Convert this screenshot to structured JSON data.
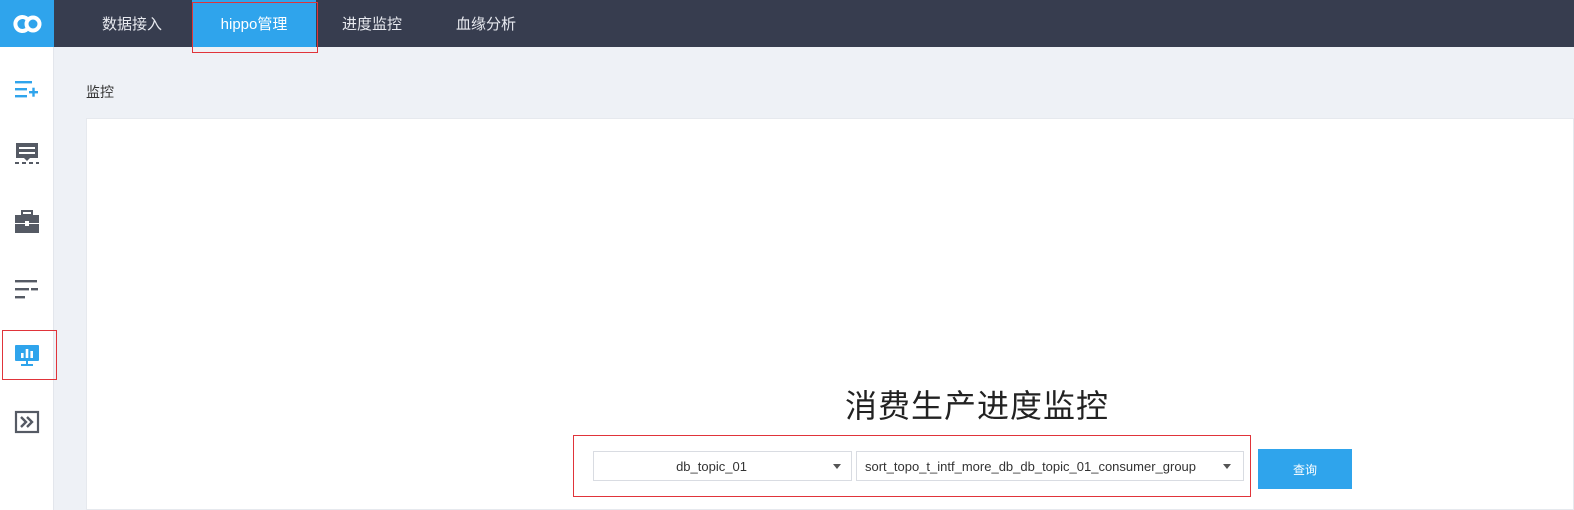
{
  "header": {
    "logo_icon": "co-logo-icon",
    "tabs": [
      {
        "label": "数据接入",
        "active": false
      },
      {
        "label": "hippo管理",
        "active": true
      },
      {
        "label": "进度监控",
        "active": false
      },
      {
        "label": "血缘分析",
        "active": false
      }
    ]
  },
  "sidebar": {
    "items": [
      {
        "icon": "list-add-icon",
        "active": false
      },
      {
        "icon": "message-board-icon",
        "active": false
      },
      {
        "icon": "toolbox-icon",
        "active": false
      },
      {
        "icon": "align-left-icon",
        "active": false
      },
      {
        "icon": "monitor-chart-icon",
        "active": true
      },
      {
        "icon": "double-chevron-right-icon",
        "active": false
      }
    ]
  },
  "breadcrumb": "监控",
  "main": {
    "title": "消费生产进度监控",
    "topic_select": {
      "value": "db_topic_01"
    },
    "group_select": {
      "value": "sort_topo_t_intf_more_db_db_topic_01_consumer_group"
    },
    "query_label": "查询"
  },
  "colors": {
    "accent": "#2fa4ec",
    "topbar": "#373d4f",
    "highlight": "#e0343a",
    "background": "#eef1f6"
  }
}
